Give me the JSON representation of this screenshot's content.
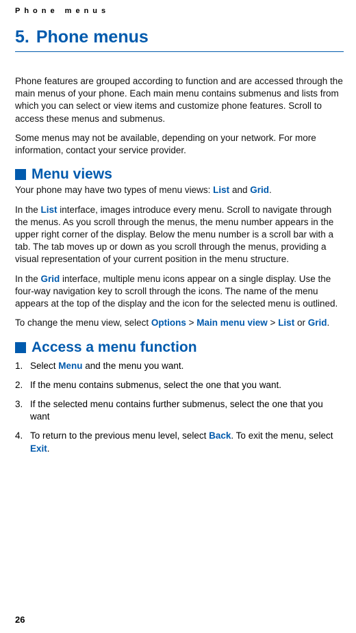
{
  "header": {
    "running": "Phone menus"
  },
  "chapter": {
    "number": "5.",
    "title": "Phone menus"
  },
  "intro": {
    "p1": "Phone features are grouped according to function and are accessed through the main menus of your phone. Each main menu contains submenus and lists from which you can select or view items and customize phone features. Scroll to access these menus and submenus.",
    "p2": "Some menus may not be available, depending on your network. For more information, contact your service provider."
  },
  "section1": {
    "title": "Menu views",
    "p1a": "Your phone may have two types of menu views: ",
    "p1b": " and ",
    "p1c": ".",
    "list_word": "List",
    "grid_word": "Grid",
    "p2a": "In the ",
    "p2b": " interface, images introduce every menu. Scroll to navigate through the menus. As you scroll through the menus, the menu number appears in the upper right corner of the display. Below the menu number is a scroll bar with a tab. The tab moves up or down as you scroll through the menus, providing a visual representation of your current position in the menu structure.",
    "p3a": "In the ",
    "p3b": " interface, multiple menu icons appear on a single display. Use the four-way navigation key to scroll through the icons. The name of the menu appears at the top of the display and the icon for the selected menu is outlined.",
    "p4a": "To change the menu view, select ",
    "p4_options": "Options",
    "p4_gt1": " > ",
    "p4_mainmenu": "Main menu view",
    "p4_gt2": " > ",
    "p4_or": " or ",
    "p4_end": "."
  },
  "section2": {
    "title": "Access a menu function",
    "steps": {
      "s1a": "Select ",
      "s1_menu": "Menu",
      "s1b": " and the menu you want.",
      "s2": "If the menu contains submenus, select the one that you want.",
      "s3": "If the selected menu contains further submenus, select the one that you want",
      "s4a": "To return to the previous menu level, select ",
      "s4_back": "Back",
      "s4b": ". To exit the menu, select ",
      "s4_exit": "Exit",
      "s4c": "."
    },
    "nums": {
      "n1": "1.",
      "n2": "2.",
      "n3": "3.",
      "n4": "4."
    }
  },
  "footer": {
    "page": "26"
  }
}
